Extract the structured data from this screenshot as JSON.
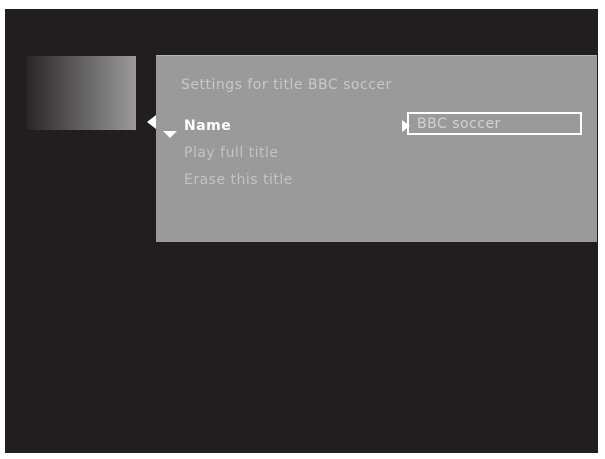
{
  "panel": {
    "title": "Settings for title BBC soccer",
    "menu": [
      {
        "label": "Name",
        "selected": true
      },
      {
        "label": "Play full title",
        "selected": false
      },
      {
        "label": "Erase this title",
        "selected": false
      }
    ],
    "name_field_value": "BBC soccer"
  },
  "icons": {
    "left_arrow": "triangle-left-icon",
    "down_arrow": "triangle-down-icon",
    "right_arrow": "triangle-right-icon"
  },
  "colors": {
    "background": "#221e1f",
    "panel": "#9a9a9b",
    "selected_text": "#ffffff",
    "dim_text": "#c3c3c3"
  }
}
